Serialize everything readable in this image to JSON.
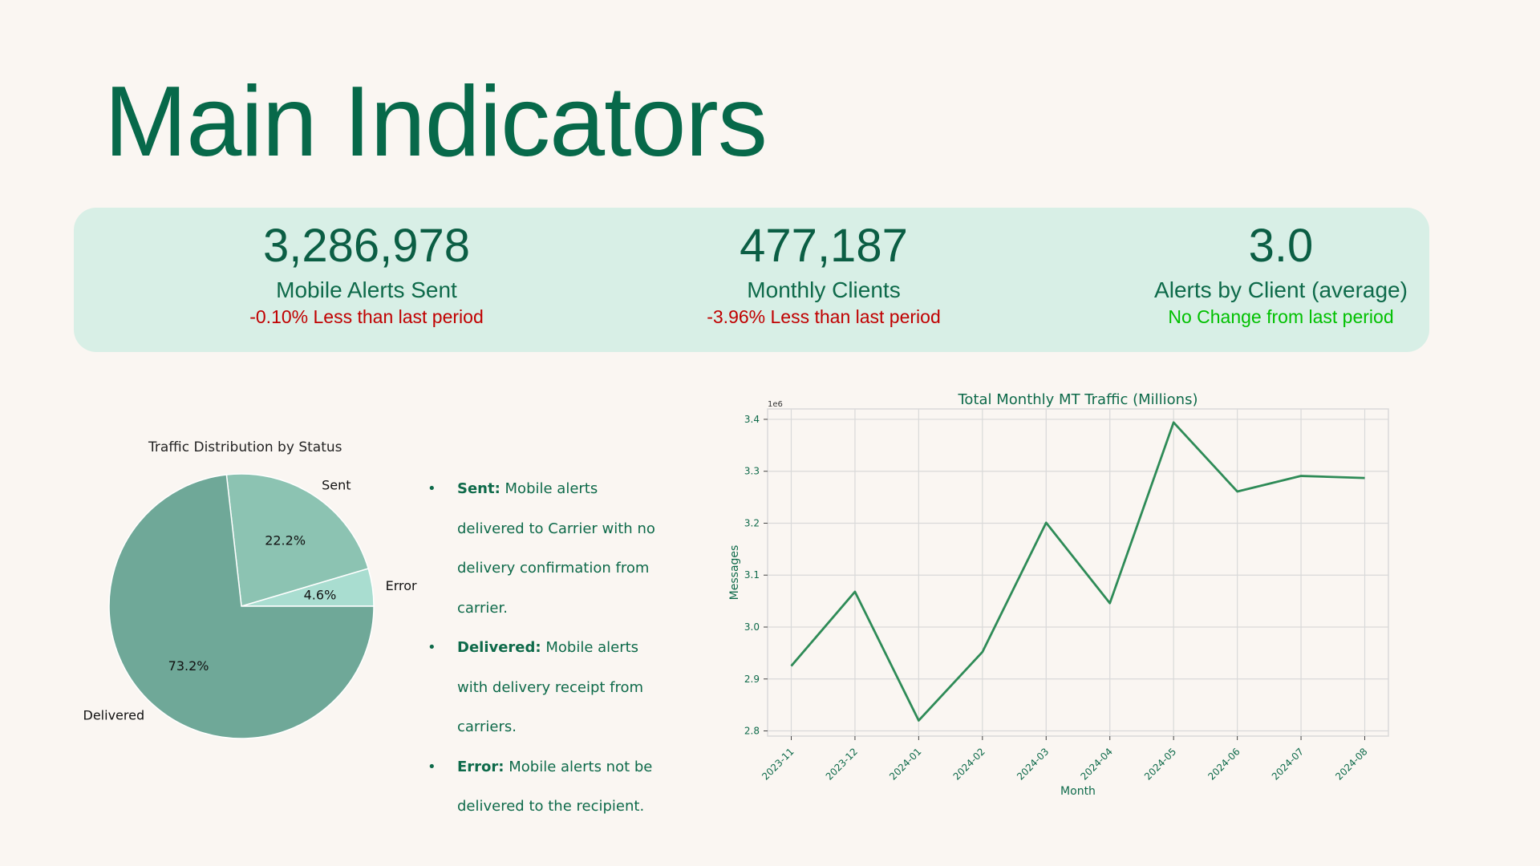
{
  "page": {
    "title": "Main Indicators"
  },
  "kpis": [
    {
      "value": "3,286,978",
      "label": "Mobile Alerts Sent",
      "change": "-0.10% Less than last period",
      "change_color": "#c00000"
    },
    {
      "value": "477,187",
      "label": "Monthly Clients",
      "change": "-3.96% Less than last period",
      "change_color": "#c00000"
    },
    {
      "value": "3.0",
      "label": "Alerts by Client (average)",
      "change": "No Change from last period",
      "change_color": "#00c000"
    }
  ],
  "pie_title": "Traffic Distribution by Status",
  "bullets": [
    {
      "term": "Sent:",
      "lines": [
        "Mobile alerts",
        "delivered to Carrier with no",
        "delivery confirmation from",
        "carrier."
      ]
    },
    {
      "term": "Delivered:",
      "lines": [
        "Mobile alerts",
        "with delivery receipt from",
        "carriers."
      ]
    },
    {
      "term": "Error:",
      "lines": [
        "Mobile alerts not be",
        "delivered to the recipient."
      ]
    }
  ],
  "colors": {
    "title": "#07694a",
    "kpi_bg": "#d8efe6",
    "line": "#2e8b57",
    "grid": "#d9d9d9",
    "pie_delivered": "#6fa898",
    "pie_sent": "#8cc3b2",
    "pie_error": "#a9ddd0"
  },
  "chart_data": [
    {
      "type": "pie",
      "title": "Traffic Distribution by Status",
      "labels": [
        "Delivered",
        "Sent",
        "Error"
      ],
      "values": [
        73.2,
        22.2,
        4.6
      ],
      "value_labels": [
        "73.2%",
        "22.2%",
        "4.6%"
      ]
    },
    {
      "type": "line",
      "title": "Total Monthly MT Traffic (Millions)",
      "xlabel": "Month",
      "ylabel": "Messages",
      "y_offset_label": "1e6",
      "categories": [
        "2023-11",
        "2023-12",
        "2024-01",
        "2024-02",
        "2024-03",
        "2024-04",
        "2024-05",
        "2024-06",
        "2024-07",
        "2024-08"
      ],
      "series": [
        {
          "values": [
            2925000,
            3068000,
            2820000,
            2952000,
            3201000,
            3046000,
            3394000,
            3261000,
            3291000,
            3287000
          ]
        }
      ],
      "yticks": [
        "2.8",
        "2.9",
        "3.0",
        "3.1",
        "3.2",
        "3.3",
        "3.4"
      ],
      "ylim": [
        2790000,
        3420000
      ],
      "grid": true
    }
  ]
}
